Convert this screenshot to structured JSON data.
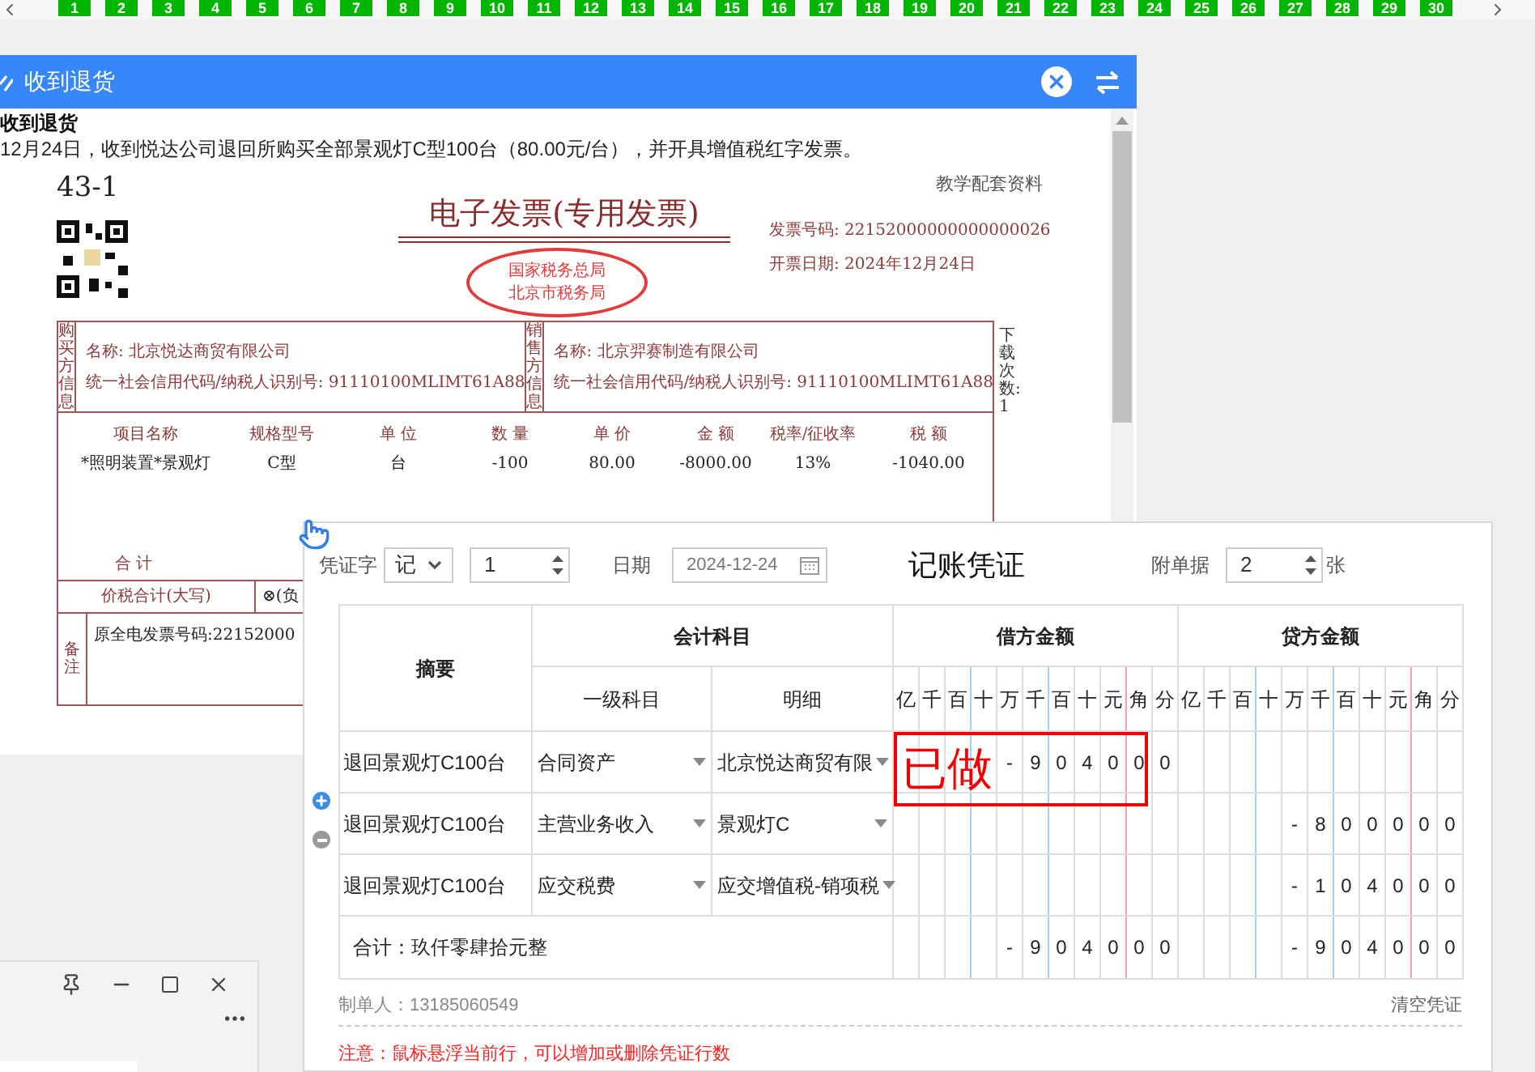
{
  "page_strip": {
    "numbers": [
      "1",
      "2",
      "3",
      "4",
      "5",
      "6",
      "7",
      "8",
      "9",
      "10",
      "11",
      "12",
      "13",
      "14",
      "15",
      "16",
      "17",
      "18",
      "19",
      "20",
      "21",
      "22",
      "23",
      "24",
      "25",
      "26",
      "27",
      "28",
      "29",
      "30"
    ]
  },
  "task_window": {
    "title": "收到退货",
    "task_title": "收到退货",
    "task_text": "12月24日，收到悦达公司退回所购买全部景观灯C型100台（80.00元/台），并开具增值税红字发票。",
    "invoice": {
      "serial": "43-1",
      "note": "教学配套资料",
      "title": "电子发票(专用发票)",
      "stamp": [
        "国家税务总局",
        "北京市税务局"
      ],
      "fields": [
        "发票号码: 22152000000000000026",
        "开票日期: 2024年12月24日"
      ],
      "buyer": {
        "label": "购买方信息",
        "name": "名称: 北京悦达商贸有限公司",
        "id": "统一社会信用代码/纳税人识别号: 91110100MLIMT61A88"
      },
      "seller": {
        "label": "销售方信息",
        "name": "名称: 北京羿赛制造有限公司",
        "id": "统一社会信用代码/纳税人识别号: 91110100MLIMT61A88"
      },
      "side_note": "下载次数:1",
      "columns": [
        "项目名称",
        "规格型号",
        "单 位",
        "数 量",
        "单 价",
        "金 额",
        "税率/征收率",
        "税 额"
      ],
      "rows": [
        [
          "*照明装置*景观灯",
          "C型",
          "台",
          "-100",
          "80.00",
          "-8000.00",
          "13%",
          "-1040.00"
        ]
      ],
      "total_label": "合 计",
      "grand_total_label": "价税合计(大写)",
      "grand_total_value": "⊗(负",
      "remarks_label": "备注",
      "remarks": "原全电发票号码:22152000"
    }
  },
  "voucher": {
    "word_label": "凭证字",
    "word": "记",
    "number": "1",
    "date_label": "日期",
    "date": "2024-12-24",
    "title": "记账凭证",
    "attach_label": "附单据",
    "attachments": "2",
    "attach_unit": "张",
    "headers": {
      "summary": "摘要",
      "account": "会计科目",
      "account_main": "一级科目",
      "account_detail": "明细",
      "debit": "借方金额",
      "credit": "贷方金额"
    },
    "debit_units": [
      "亿",
      "千",
      "百",
      "十",
      "万",
      "千",
      "百",
      "十",
      "元",
      "角",
      "分"
    ],
    "credit_units": [
      "亿",
      "千",
      "百",
      "十",
      "万",
      "千",
      "百",
      "十",
      "元",
      "角",
      "分"
    ],
    "rows": [
      {
        "summary": "退回景观灯C100台",
        "account": "合同资产",
        "detail": "北京悦达商贸有限",
        "debit": "- 9 0 4 0 0 0"
      },
      {
        "summary": "退回景观灯C100台",
        "account": "主营业务收入",
        "detail": "景观灯C",
        "credit": "- 8 0 0 0 0 0"
      },
      {
        "summary": "退回景观灯C100台",
        "account": "应交税费",
        "detail": "应交增值税-销项税",
        "credit": "- 1 0 4 0 0 0"
      }
    ],
    "total": {
      "label": "合计：玖仟零肆拾元整",
      "debit": "- 9 0 4 0 0 0",
      "credit": "- 9 0 4 0 0 0"
    },
    "stamp": "已做",
    "maker": "制单人：13185060549",
    "clear": "清空凭证",
    "notice": "注意：鼠标悬浮当前行，可以增加或删除凭证行数"
  }
}
